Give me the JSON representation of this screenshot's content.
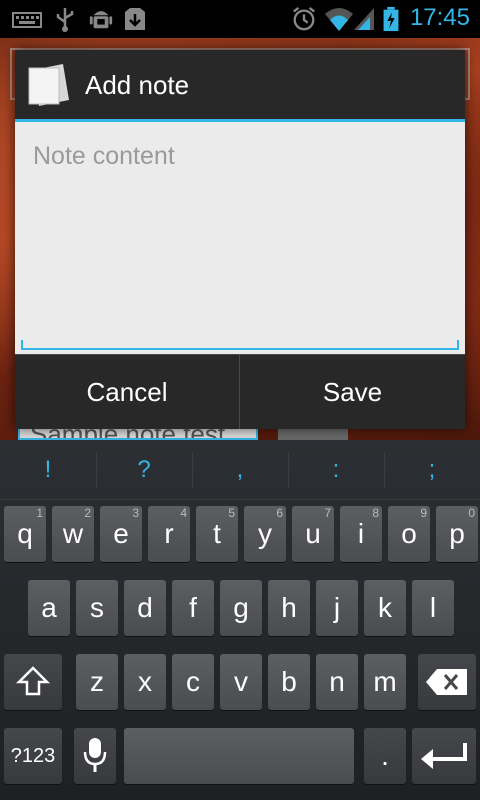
{
  "status_bar": {
    "time": "17:45",
    "left_icons": [
      "keyboard-icon",
      "usb-icon",
      "android-debug-icon",
      "download-icon"
    ],
    "right_icons": [
      "alarm-icon",
      "wifi-icon",
      "signal-icon",
      "battery-charging-icon"
    ]
  },
  "background_app": {
    "item_text": "Sample note test"
  },
  "dialog": {
    "title": "Add note",
    "icon": "note-icon",
    "input_placeholder": "Note content",
    "input_value": "",
    "cancel_label": "Cancel",
    "save_label": "Save"
  },
  "keyboard": {
    "suggestions": [
      "!",
      "?",
      ",",
      ":",
      ";"
    ],
    "row1": [
      {
        "k": "q",
        "h": "1"
      },
      {
        "k": "w",
        "h": "2"
      },
      {
        "k": "e",
        "h": "3"
      },
      {
        "k": "r",
        "h": "4"
      },
      {
        "k": "t",
        "h": "5"
      },
      {
        "k": "y",
        "h": "6"
      },
      {
        "k": "u",
        "h": "7"
      },
      {
        "k": "i",
        "h": "8"
      },
      {
        "k": "o",
        "h": "9"
      },
      {
        "k": "p",
        "h": "0"
      }
    ],
    "row2": [
      "a",
      "s",
      "d",
      "f",
      "g",
      "h",
      "j",
      "k",
      "l"
    ],
    "row3": [
      "z",
      "x",
      "c",
      "v",
      "b",
      "n",
      "m"
    ],
    "symbols_label": "?123",
    "period_label": ".",
    "shift_icon": "shift-icon",
    "backspace_icon": "backspace-icon",
    "mic_icon": "microphone-icon",
    "enter_icon": "enter-icon"
  },
  "colors": {
    "accent": "#33b5e5",
    "dialog_bg": "#282828",
    "input_bg": "#ebebeb"
  }
}
